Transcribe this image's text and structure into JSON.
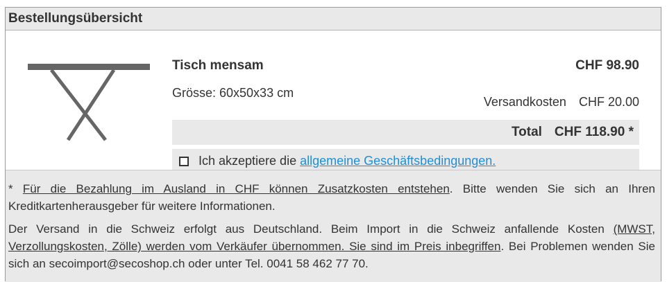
{
  "header": {
    "title": "Bestellungsübersicht"
  },
  "product": {
    "name": "Tisch mensam",
    "price": "CHF 98.90",
    "size": "Grösse: 60x50x33 cm",
    "image_icon": "table-icon"
  },
  "shipping": {
    "label": "Versandkosten",
    "value": "CHF 20.00"
  },
  "total": {
    "label": "Total",
    "value": "CHF 118.90 *"
  },
  "terms": {
    "checked": false,
    "text": "Ich akzeptiere die",
    "link": "allgemeine Geschäftsbedingungen."
  },
  "notes": {
    "p1_prefix": "* ",
    "p1_underlined": "Für die Bezahlung im Ausland in CHF können Zusatzkosten entstehen",
    "p1_rest": ". Bitte wenden Sie sich an Ihren Kreditkartenherausgeber für weitere Informationen.",
    "p2_start": "Der Versand in die Schweiz erfolgt aus Deutschland. Beim Import in die Schweiz anfallende Kosten ",
    "p2_underlined": "(MWST, Verzollungskosten, Zölle) werden vom Verkäufer übernommen. Sie sind im Preis inbegriffen",
    "p2_rest": ". Bei Problemen  wenden Sie sich an secoimport@secoshop.ch oder unter Tel. 0041 58 462 77 70."
  },
  "colors": {
    "link": "#1e8fd6",
    "panel": "#e9e9e9",
    "table": "#666666"
  }
}
